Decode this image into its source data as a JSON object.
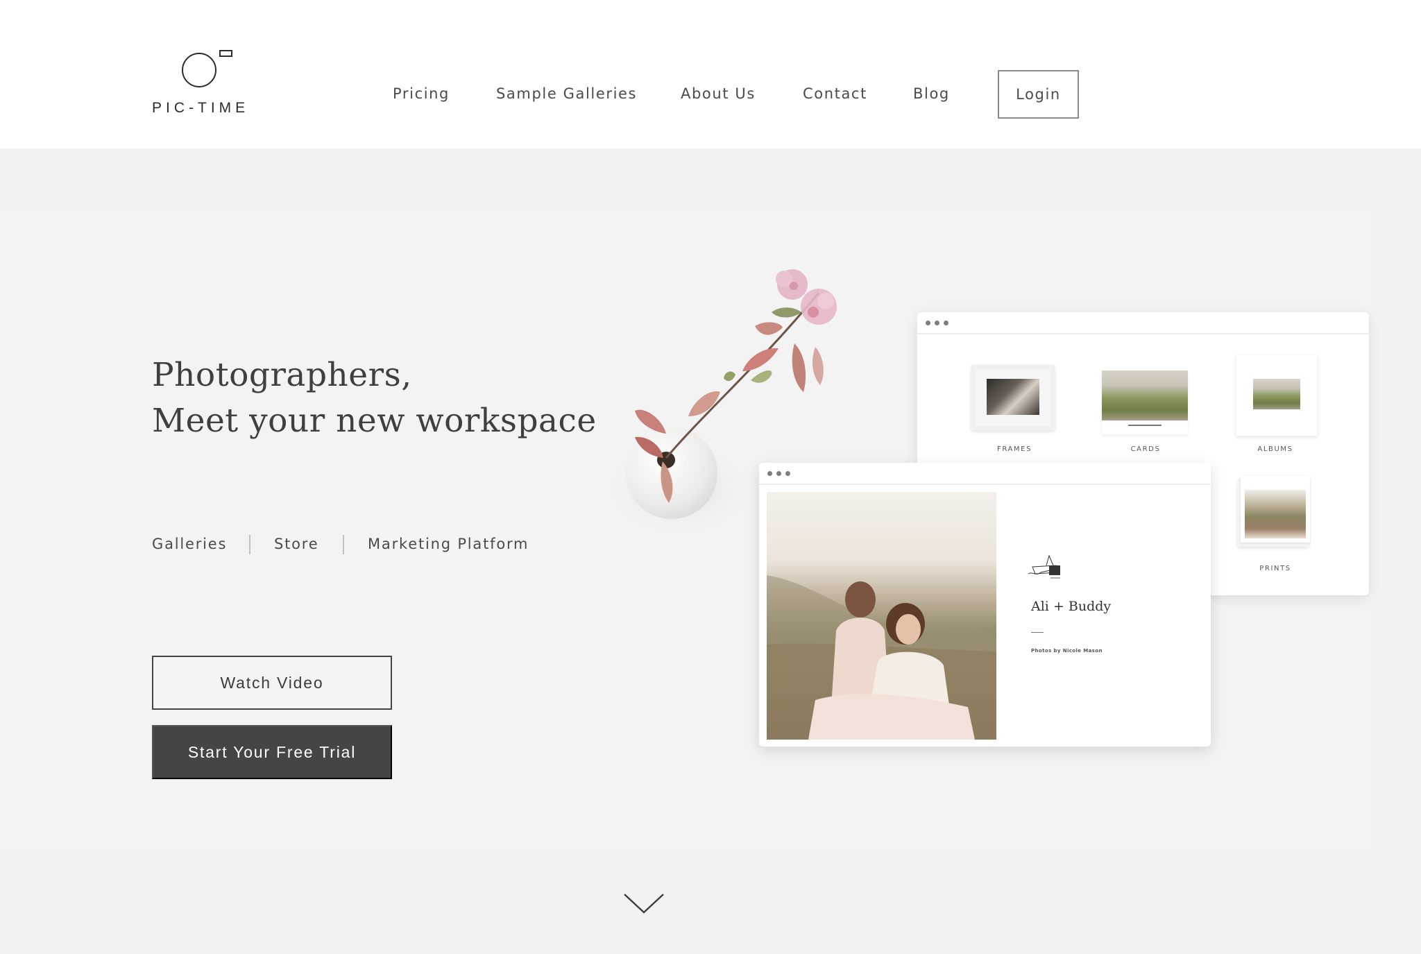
{
  "brand": {
    "name": "PIC-TIME",
    "logo_icon": "camera-circle-icon"
  },
  "nav": {
    "items": [
      {
        "label": "Pricing"
      },
      {
        "label": "Sample Galleries"
      },
      {
        "label": "About Us"
      },
      {
        "label": "Contact"
      },
      {
        "label": "Blog"
      }
    ],
    "login_label": "Login"
  },
  "hero": {
    "headline_line1": "Photographers,",
    "headline_line2": "Meet your new workspace",
    "sublinks": [
      {
        "label": "Galleries"
      },
      {
        "label": "Store"
      },
      {
        "label": "Marketing Platform"
      }
    ],
    "watch_video_label": "Watch Video",
    "free_trial_label": "Start Your Free Trial",
    "scroll_icon": "chevron-down-icon"
  },
  "mockup": {
    "store_window": {
      "products": [
        {
          "label": "FRAMES"
        },
        {
          "label": "CARDS"
        },
        {
          "label": "ALBUMS"
        },
        {
          "label": "PRINTS"
        }
      ]
    },
    "gallery_window": {
      "title": "Ali + Buddy",
      "credit": "Photos by Nicole Mason"
    }
  },
  "colors": {
    "header_bg": "#ffffff",
    "page_bg": "#f2f2f2",
    "text": "#4a4a4a",
    "primary_button_bg": "#454545",
    "primary_button_text": "#ffffff"
  }
}
